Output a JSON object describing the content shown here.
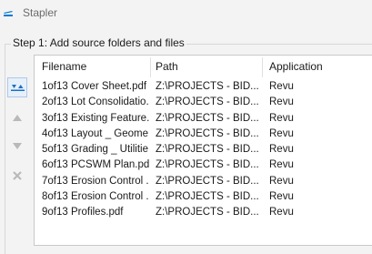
{
  "window": {
    "title": "Stapler",
    "app_icon": "stapler-icon",
    "accent": "#0078d4"
  },
  "step1": {
    "label": "Step 1: Add source folders and files",
    "buttons": [
      {
        "name": "move-to-top",
        "icon": "double-chevron-up-icon"
      },
      {
        "name": "move-up",
        "icon": "triangle-up-icon"
      },
      {
        "name": "move-down",
        "icon": "triangle-down-icon"
      },
      {
        "name": "remove",
        "icon": "x-icon"
      }
    ],
    "columns": [
      "Filename",
      "Path",
      "Application"
    ],
    "rows": [
      {
        "filename": "1of13 Cover Sheet.pdf",
        "path": "Z:\\PROJECTS - BID...",
        "application": "Revu"
      },
      {
        "filename": "2of13 Lot Consolidatio...",
        "path": "Z:\\PROJECTS - BID...",
        "application": "Revu"
      },
      {
        "filename": "3of13 Existing Feature...",
        "path": "Z:\\PROJECTS - BID...",
        "application": "Revu"
      },
      {
        "filename": "4of13 Layout _ Geome...",
        "path": "Z:\\PROJECTS - BID...",
        "application": "Revu"
      },
      {
        "filename": "5of13 Grading _ Utilitie...",
        "path": "Z:\\PROJECTS - BID...",
        "application": "Revu"
      },
      {
        "filename": "6of13 PCSWM Plan.pdf",
        "path": "Z:\\PROJECTS - BID...",
        "application": "Revu"
      },
      {
        "filename": "7of13 Erosion Control ...",
        "path": "Z:\\PROJECTS - BID...",
        "application": "Revu"
      },
      {
        "filename": "8of13 Erosion Control ...",
        "path": "Z:\\PROJECTS - BID...",
        "application": "Revu"
      },
      {
        "filename": "9of13 Profiles.pdf",
        "path": "Z:\\PROJECTS - BID...",
        "application": "Revu"
      }
    ]
  }
}
